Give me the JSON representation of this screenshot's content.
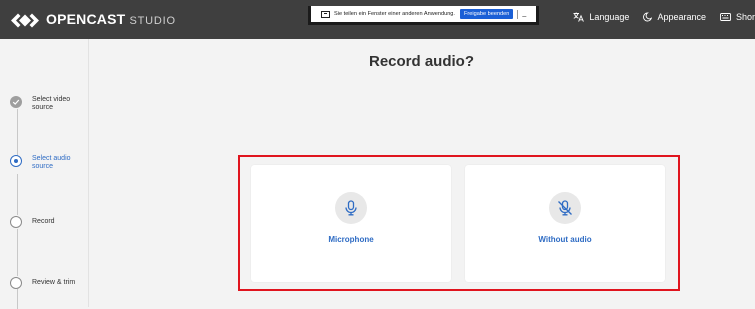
{
  "header": {
    "logo_brand": "OPENCAST",
    "logo_sub": "STUDIO",
    "language_label": "Language",
    "appearance_label": "Appearance",
    "shortcuts_label": "Shor"
  },
  "screen_share_bar": {
    "message": "Sie teilen ein Fenster einer anderen Anwendung.",
    "stop_button": "Freigabe beenden",
    "hide_button": "_"
  },
  "steps": [
    {
      "label": "Select video source",
      "state": "done"
    },
    {
      "label": "Select audio source",
      "state": "active"
    },
    {
      "label": "Record",
      "state": "todo"
    },
    {
      "label": "Review & trim",
      "state": "todo"
    }
  ],
  "main": {
    "title": "Record audio?",
    "options": [
      {
        "label": "Microphone",
        "icon": "microphone-icon"
      },
      {
        "label": "Without audio",
        "icon": "microphone-off-icon"
      }
    ]
  },
  "colors": {
    "topbar": "#3f3f3f",
    "accent": "#2f6cc4",
    "highlight": "#e0141e",
    "background": "#f3f3f3"
  }
}
